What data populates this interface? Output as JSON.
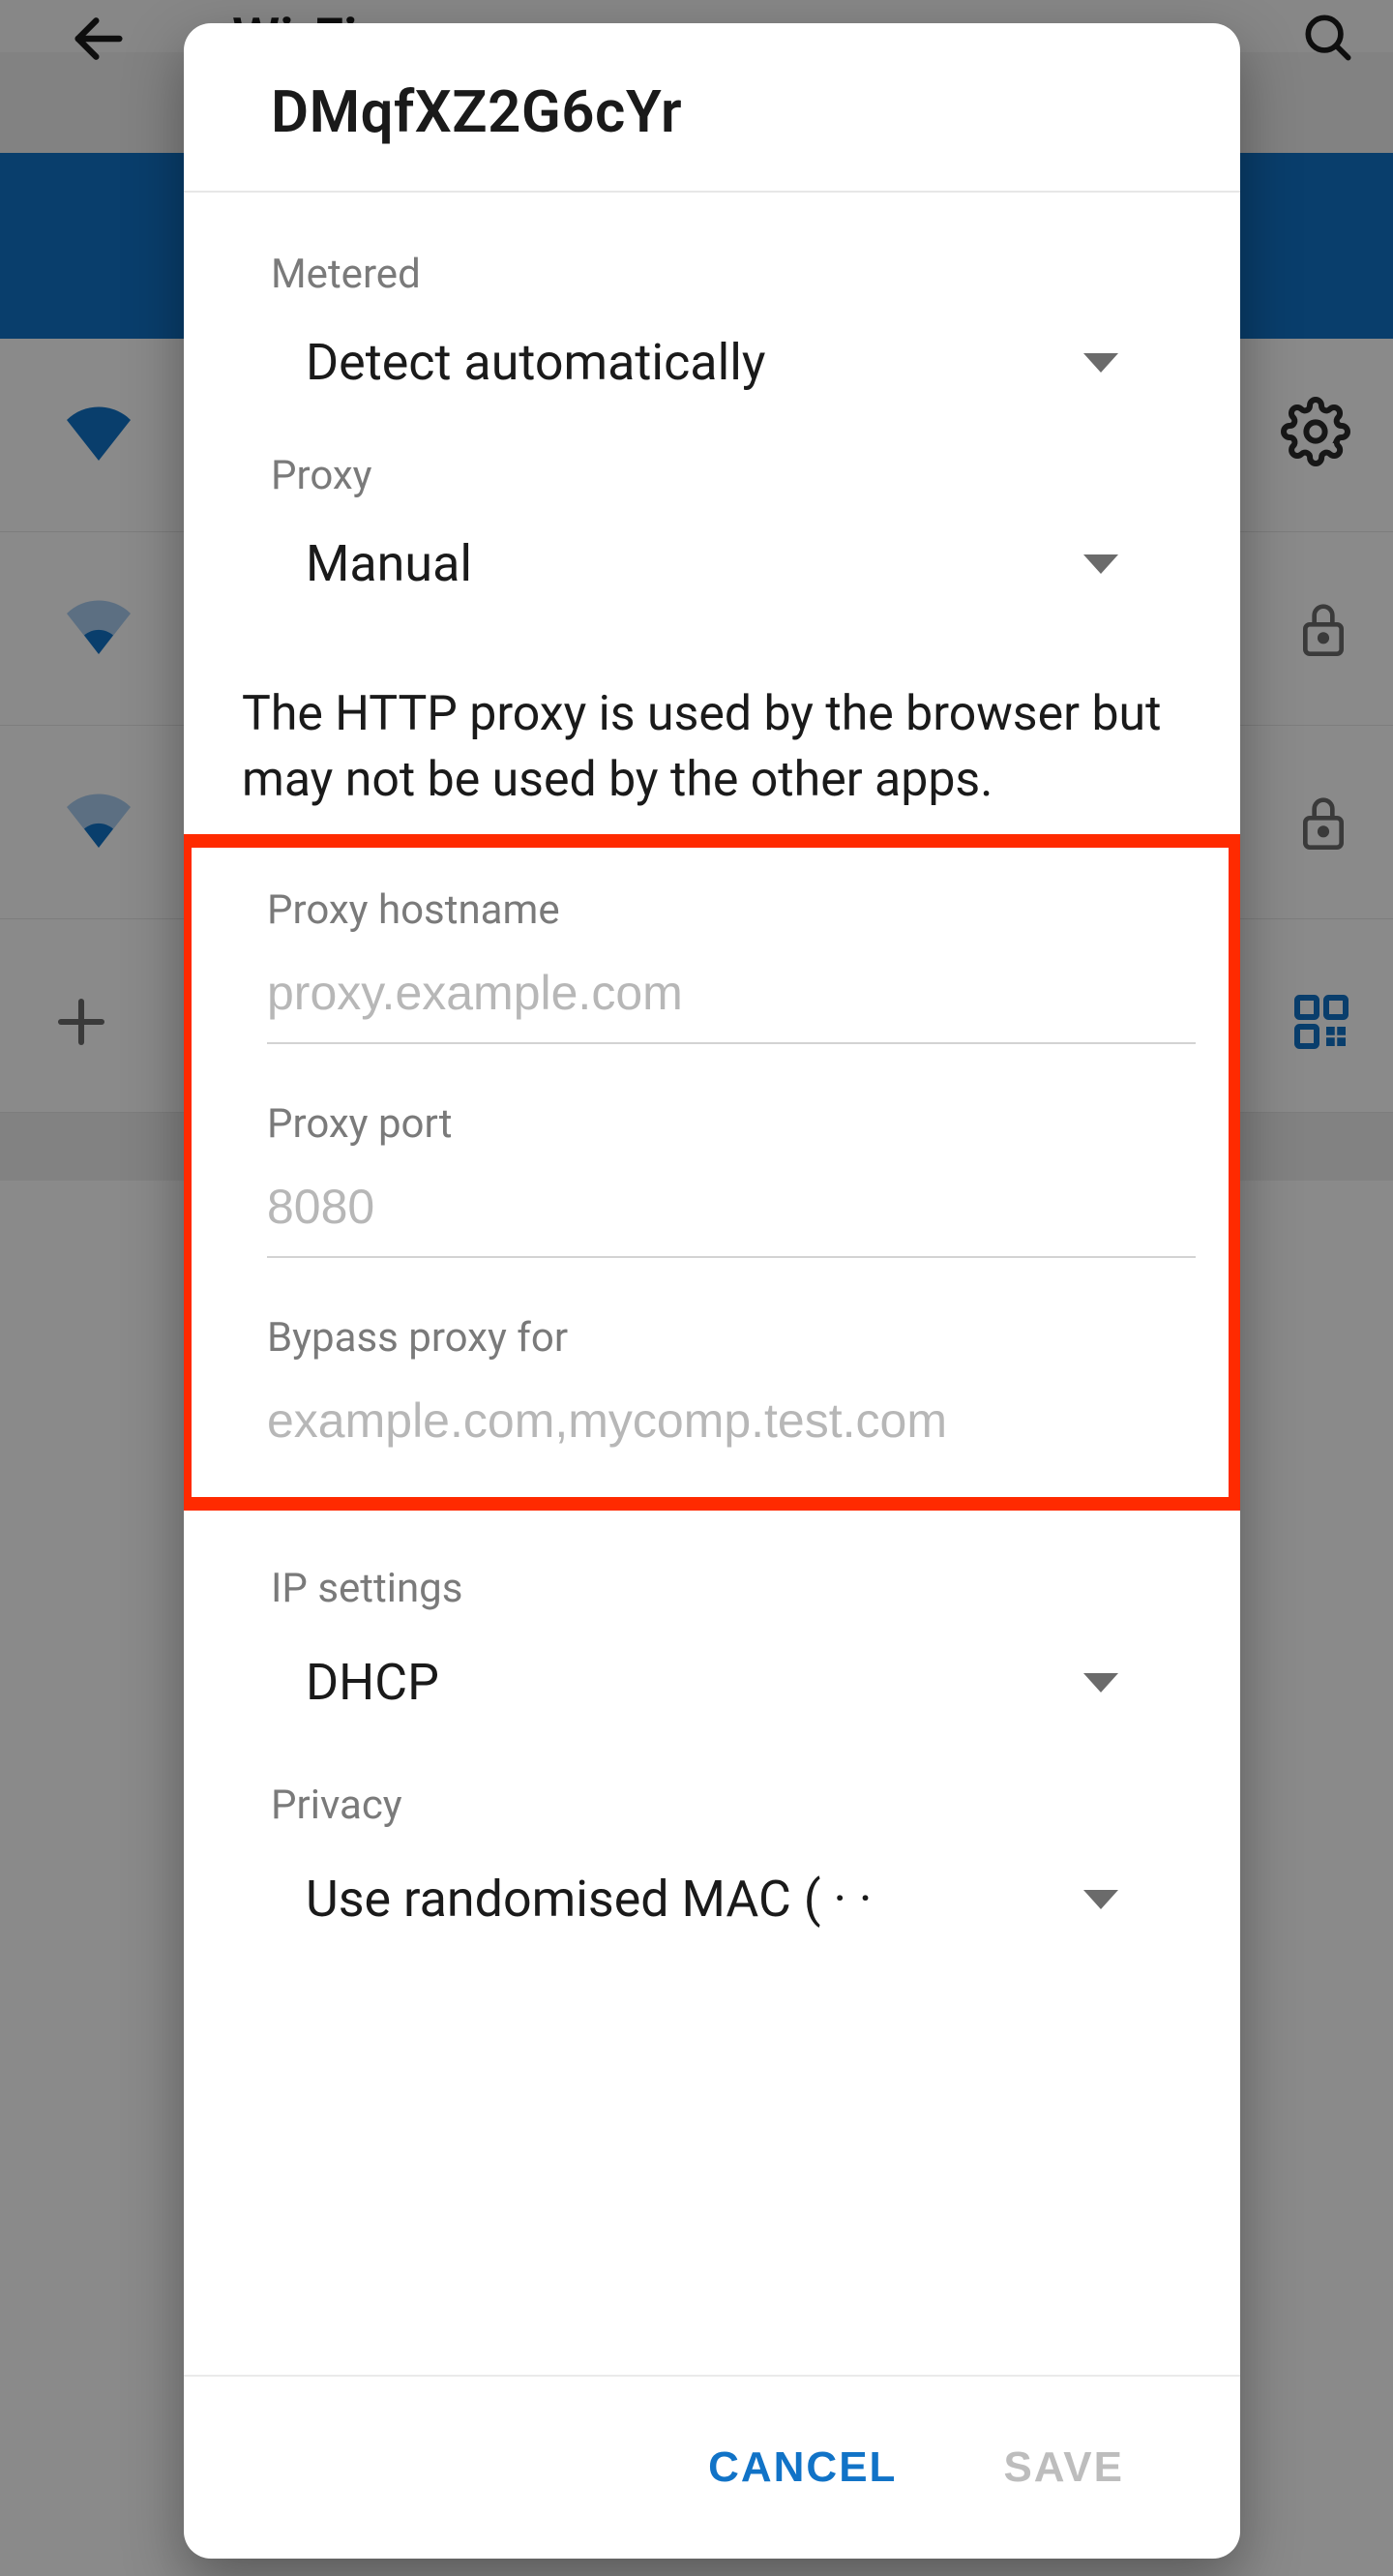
{
  "background": {
    "page_title": "Wi-Fi"
  },
  "dialog": {
    "title": "DMqfXZ2G6cYr",
    "metered": {
      "label": "Metered",
      "value": "Detect automatically"
    },
    "proxy": {
      "label": "Proxy",
      "value": "Manual",
      "info": "The HTTP proxy is used by the browser but may not be used by the other apps.",
      "hostname_label": "Proxy hostname",
      "hostname_placeholder": "proxy.example.com",
      "hostname_value": "",
      "port_label": "Proxy port",
      "port_placeholder": "8080",
      "port_value": "",
      "bypass_label": "Bypass proxy for",
      "bypass_placeholder": "example.com,mycomp.test.com",
      "bypass_value": ""
    },
    "ip": {
      "label": "IP settings",
      "value": "DHCP"
    },
    "privacy": {
      "label": "Privacy",
      "value": "Use randomised MAC ( · ·"
    },
    "footer": {
      "cancel": "CANCEL",
      "save": "SAVE"
    }
  }
}
